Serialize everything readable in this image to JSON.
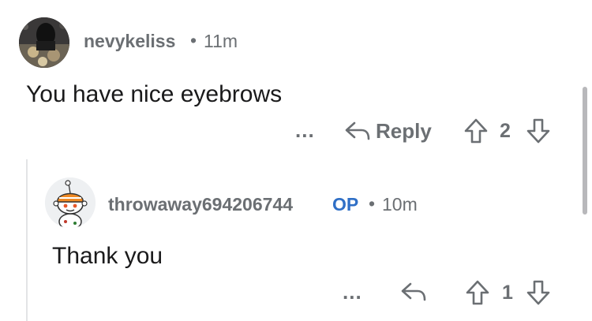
{
  "comments": [
    {
      "username": "nevykeliss",
      "separator": "•",
      "time": "11m",
      "body": "You have nice eyebrows",
      "actions": {
        "more": "...",
        "reply_label": "Reply",
        "score": "2"
      }
    },
    {
      "username": "throwaway694206744",
      "badge": "OP",
      "separator": "•",
      "time": "10m",
      "body": "Thank you",
      "actions": {
        "more": "...",
        "score": "1"
      }
    }
  ],
  "icons": {
    "reply": "reply-arrow-icon",
    "upvote": "upvote-arrow-icon",
    "downvote": "downvote-arrow-icon"
  },
  "colors": {
    "meta_text": "#6b6f73",
    "body_text": "#1a1a1b",
    "op_badge": "#2f6fc6"
  }
}
